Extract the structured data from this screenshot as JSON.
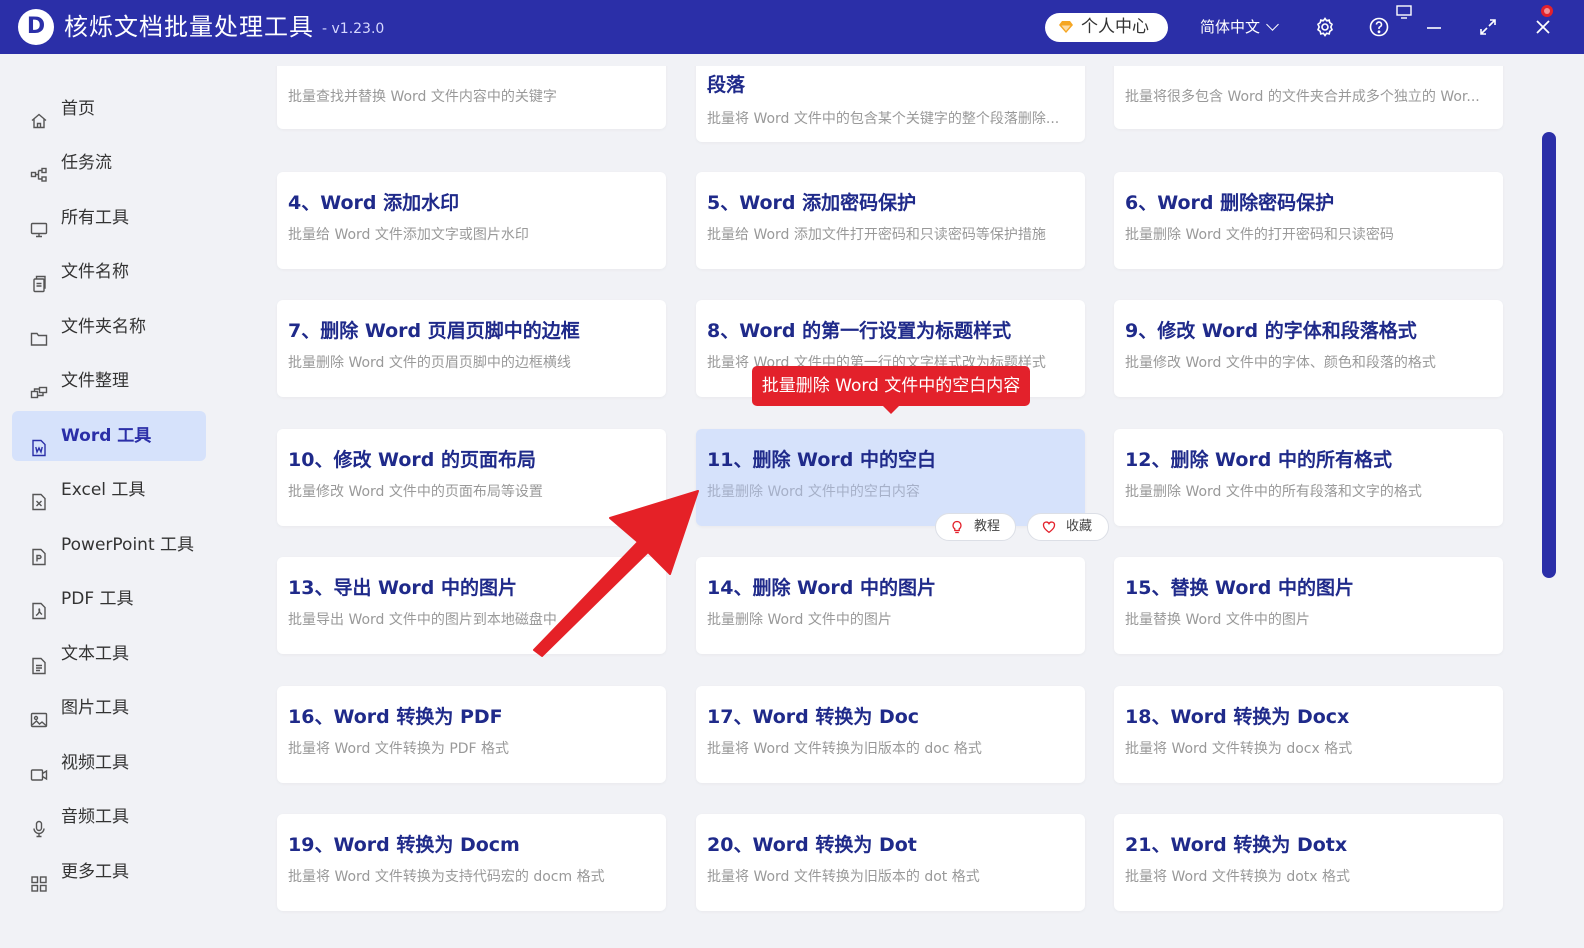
{
  "app": {
    "title": "核烁文档批量处理工具",
    "version": "- v1.23.0",
    "user_center": "个人中心",
    "language": "简体中文"
  },
  "colors": {
    "brand": "#2b2fa8",
    "accent_red": "#e3212b",
    "active_bg": "#d6e2fb"
  },
  "sidebar": {
    "items": [
      {
        "label": "首页",
        "icon": "home-icon"
      },
      {
        "label": "任务流",
        "icon": "workflow-icon"
      },
      {
        "label": "所有工具",
        "icon": "monitor-icon"
      },
      {
        "label": "文件名称",
        "icon": "file-copy-icon"
      },
      {
        "label": "文件夹名称",
        "icon": "folder-icon"
      },
      {
        "label": "文件整理",
        "icon": "organize-icon"
      },
      {
        "label": "Word 工具",
        "icon": "word-file-icon"
      },
      {
        "label": "Excel 工具",
        "icon": "excel-file-icon"
      },
      {
        "label": "PowerPoint 工具",
        "icon": "ppt-file-icon"
      },
      {
        "label": "PDF 工具",
        "icon": "pdf-file-icon"
      },
      {
        "label": "文本工具",
        "icon": "text-file-icon"
      },
      {
        "label": "图片工具",
        "icon": "image-icon"
      },
      {
        "label": "视频工具",
        "icon": "video-icon"
      },
      {
        "label": "音频工具",
        "icon": "microphone-icon"
      },
      {
        "label": "更多工具",
        "icon": "grid-icon"
      }
    ]
  },
  "cards": [
    {
      "title": "",
      "desc": "批量查找并替换 Word 文件内容中的关键字"
    },
    {
      "title": "段落",
      "desc": "批量将 Word 文件中的包含某个关键字的整个段落删除..."
    },
    {
      "title": "",
      "desc": "批量将很多包含 Word 的文件夹合并成多个独立的 Wor..."
    },
    {
      "title": "4、Word 添加水印",
      "desc": "批量给 Word 文件添加文字或图片水印"
    },
    {
      "title": "5、Word 添加密码保护",
      "desc": "批量给 Word 添加文件打开密码和只读密码等保护措施"
    },
    {
      "title": "6、Word 删除密码保护",
      "desc": "批量删除 Word 文件的打开密码和只读密码"
    },
    {
      "title": "7、删除 Word 页眉页脚中的边框",
      "desc": "批量删除 Word 文件的页眉页脚中的边框横线"
    },
    {
      "title": "8、Word 的第一行设置为标题样式",
      "desc": "批量将 Word 文件中的第一行的文字样式改为标题样式"
    },
    {
      "title": "9、修改 Word 的字体和段落格式",
      "desc": "批量修改 Word 文件中的字体、颜色和段落的格式"
    },
    {
      "title": "10、修改 Word 的页面布局",
      "desc": "批量修改 Word 文件中的页面布局等设置"
    },
    {
      "title": "11、删除 Word 中的空白",
      "desc": "批量删除 Word 文件中的空白内容"
    },
    {
      "title": "12、删除 Word 中的所有格式",
      "desc": "批量删除 Word 文件中的所有段落和文字的格式"
    },
    {
      "title": "13、导出 Word 中的图片",
      "desc": "批量导出 Word 文件中的图片到本地磁盘中"
    },
    {
      "title": "14、删除 Word 中的图片",
      "desc": "批量删除 Word 文件中的图片"
    },
    {
      "title": "15、替换 Word 中的图片",
      "desc": "批量替换 Word 文件中的图片"
    },
    {
      "title": "16、Word 转换为 PDF",
      "desc": "批量将 Word 文件转换为 PDF 格式"
    },
    {
      "title": "17、Word 转换为 Doc",
      "desc": "批量将 Word 文件转换为旧版本的 doc 格式"
    },
    {
      "title": "18、Word 转换为 Docx",
      "desc": "批量将 Word 文件转换为 docx 格式"
    },
    {
      "title": "19、Word 转换为 Docm",
      "desc": "批量将 Word 文件转换为支持代码宏的 docm 格式"
    },
    {
      "title": "20、Word 转换为 Dot",
      "desc": "批量将 Word 文件转换为旧版本的 dot 格式"
    },
    {
      "title": "21、Word 转换为 Dotx",
      "desc": "批量将 Word 文件转换为 dotx 格式"
    }
  ],
  "hover_actions": {
    "tutorial": "教程",
    "favorite": "收藏"
  },
  "tooltip": "批量删除 Word 文件中的空白内容"
}
